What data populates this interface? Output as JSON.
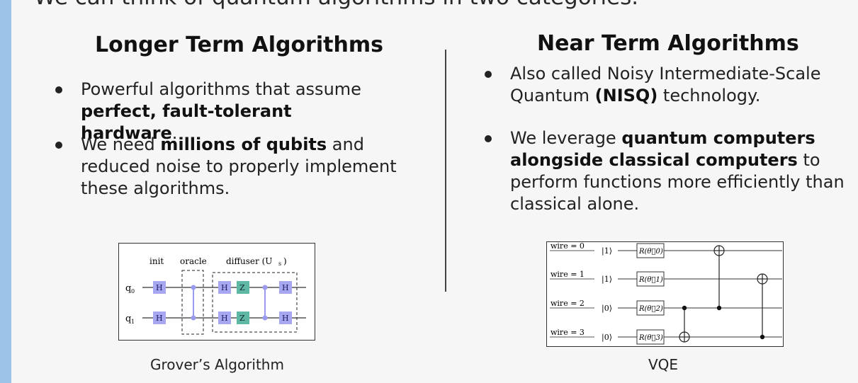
{
  "header": {
    "top_caption": "We can think of quantum algorithms in two categories."
  },
  "left": {
    "title": "Longer Term Algorithms",
    "bullet1_pre": "Powerful algorithms that assume ",
    "bullet1_bold": "perfect, fault-tolerant hardware",
    "bullet1_post": ".",
    "bullet2_pre": "We need ",
    "bullet2_bold": "millions of qubits",
    "bullet2_post": " and reduced noise to properly implement these algorithms.",
    "figure_caption": "Grover’s Algorithm"
  },
  "right": {
    "title": "Near Term Algorithms",
    "bullet1_pre": "Also called Noisy Intermediate-Scale Quantum ",
    "bullet1_bold": "(NISQ)",
    "bullet1_post": " technology.",
    "bullet2_pre": "We leverage ",
    "bullet2_bold": "quantum computers alongside classical computers",
    "bullet2_post": " to perform functions more efficiently than classical alone.",
    "figure_caption": "VQE"
  },
  "grover_circuit": {
    "label_init": "init",
    "label_oracle": "oracle",
    "label_diffuser": "diffuser (U",
    "label_diffuser_sub": "s",
    "label_diffuser_close": ")",
    "qubit0": "q",
    "qubit0_sub": "0",
    "qubit1": "q",
    "qubit1_sub": "1",
    "gate_h": "H",
    "gate_z": "Z"
  },
  "vqe_circuit": {
    "wires": [
      {
        "label": "wire = 0",
        "state": "|1⟩",
        "gate": "R(θ⃗0)"
      },
      {
        "label": "wire = 1",
        "state": "|1⟩",
        "gate": "R(θ⃗1)"
      },
      {
        "label": "wire = 2",
        "state": "|0⟩",
        "gate": "R(θ⃗2)"
      },
      {
        "label": "wire = 3",
        "state": "|0⟩",
        "gate": "R(θ⃗3)"
      }
    ]
  }
}
